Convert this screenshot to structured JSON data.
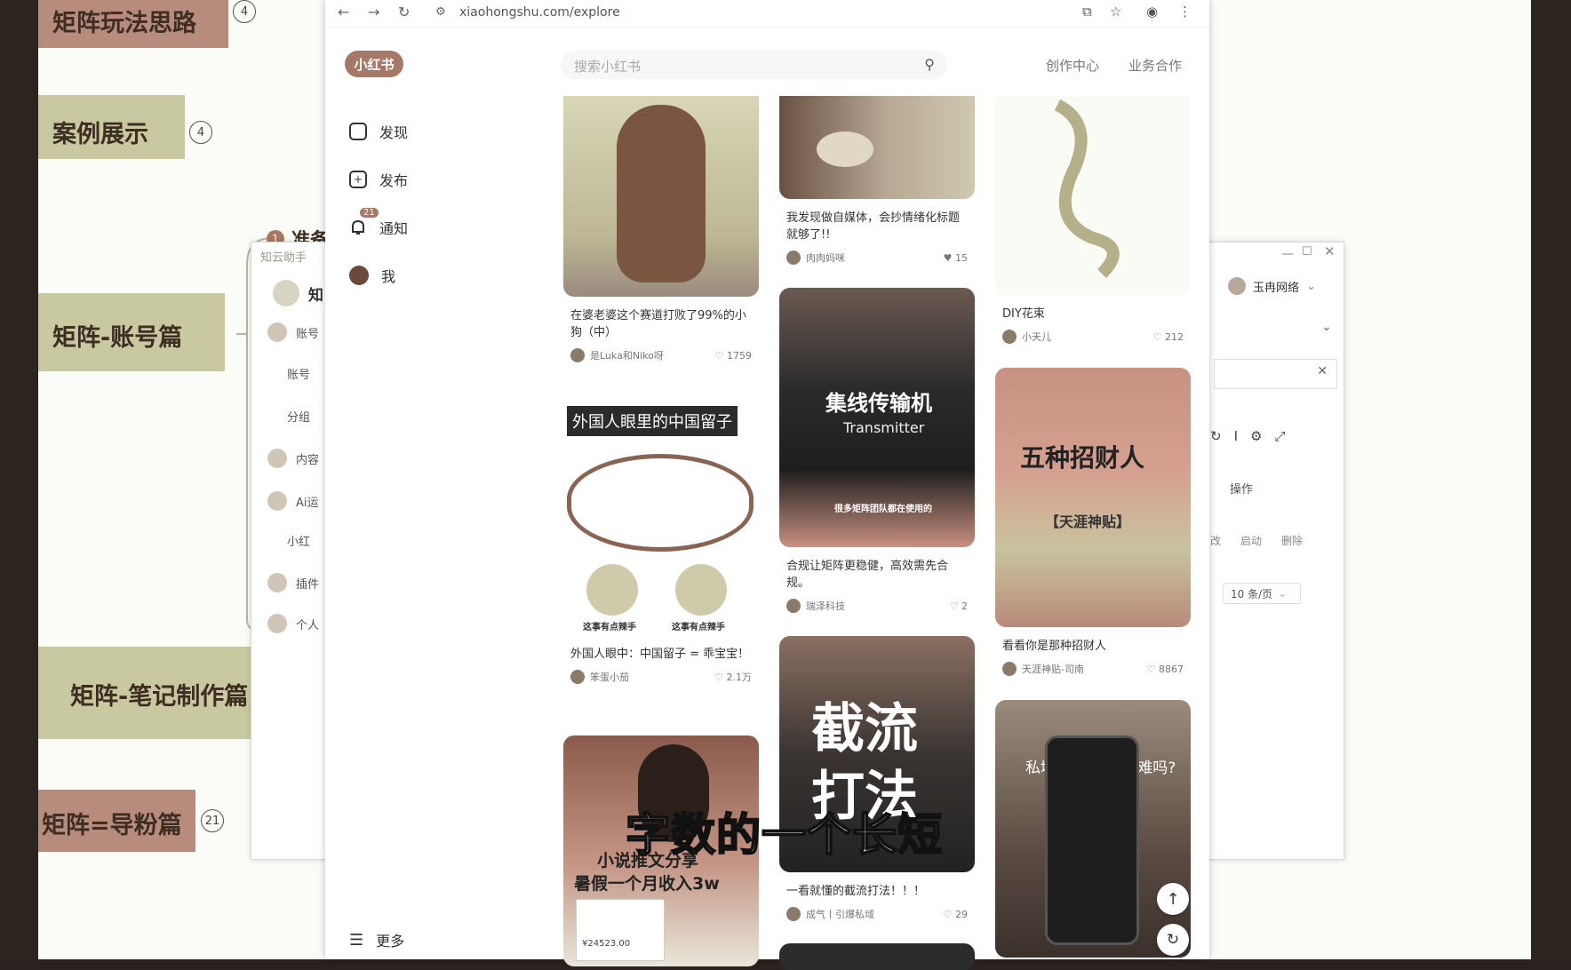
{
  "mindmap": {
    "nodes": [
      {
        "label": "矩阵玩法思路",
        "badge": "4"
      },
      {
        "label": "案例展示",
        "badge": "4"
      },
      {
        "label": "矩阵-账号篇"
      },
      {
        "label": "矩阵-笔记制作篇"
      },
      {
        "label": "矩阵=导粉篇",
        "badge": "21"
      }
    ],
    "branch_label": "准备",
    "branch_num": "1"
  },
  "zhiyun": {
    "title": "知云助手",
    "header": "知",
    "nav": [
      "账号",
      "账号",
      "分组",
      "内容",
      "Ai运",
      "小红",
      "插件",
      "个人"
    ]
  },
  "right_pane": {
    "user": "玉冉网络",
    "op_header": "操作",
    "actions": [
      "启动",
      "删除"
    ],
    "prefix": "改",
    "page_size": "10 条/页"
  },
  "browser": {
    "url": "xiaohongshu.com/explore"
  },
  "xhs": {
    "logo": "小红书",
    "nav": {
      "discover": "发现",
      "publish": "发布",
      "notify": "通知",
      "notify_badge": "21",
      "me": "我",
      "more": "更多"
    },
    "search_placeholder": "搜索小红书",
    "links": [
      "创作中心",
      "业务合作"
    ]
  },
  "feed": {
    "col1": [
      {
        "title": "在婆老婆这个赛道打败了99%的小狗（中）",
        "author": "是Luka和Niko呀",
        "likes": "1759"
      },
      {
        "banner": "外国人眼里的中国留子",
        "emoji_caption": "这事有点辣手",
        "title": "外国人眼中：中国留子 = 乖宝宝！",
        "author": "笨蛋小茄",
        "likes": "2.1万"
      },
      {
        "overlay_1": "小说推文分享",
        "overlay_2": "暑假一个月收入3w",
        "amount": "¥24523.00"
      }
    ],
    "col2": [
      {
        "title": "我发现做自媒体，会抄情绪化标题就够了!!",
        "author": "肉肉妈咪",
        "likes": "15"
      },
      {
        "overlay_1": "集线传输机",
        "overlay_2": "Transmitter",
        "overlay_3": "很多矩阵团队都在使用的",
        "title": "合规让矩阵更稳健，高效需先合规。",
        "author": "瑞泽科技",
        "likes": "2"
      },
      {
        "overlay_1": "截流",
        "overlay_2": "打法",
        "title": "一看就懂的截流打法！！！",
        "author": "成气丨引爆私域",
        "likes": "29"
      }
    ],
    "col3": [
      {
        "title": "DIY花束",
        "author": "小天儿",
        "likes": "212"
      },
      {
        "overlay_1": "五种招财人",
        "overlay_2": "【天涯神贴】",
        "title": "看看你是那种招财人",
        "author": "天涯神贴-司南",
        "likes": "8867"
      },
      {
        "overlay_1": "私域99+ 有那么难吗?"
      }
    ]
  },
  "subtitle": "字数的一个长短",
  "colors": {
    "accent": "#a57868",
    "bg_dark": "#2a221e"
  }
}
